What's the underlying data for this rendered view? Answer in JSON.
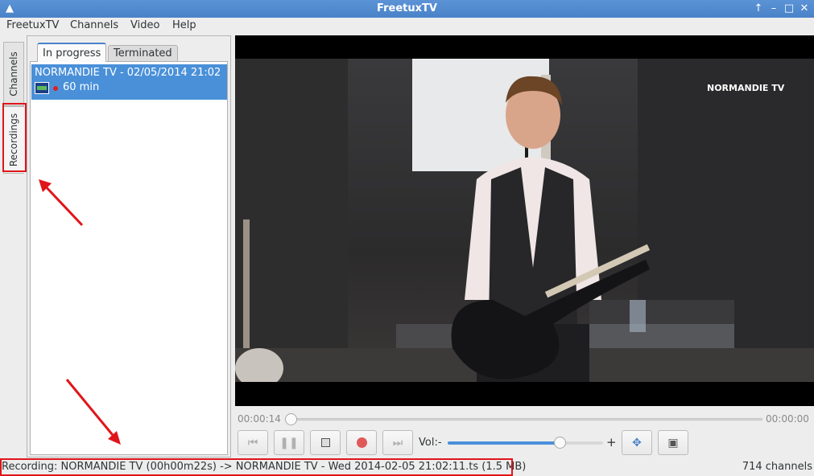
{
  "window": {
    "title": "FreetuxTV",
    "app_icon": "tux-icon",
    "buttons": [
      "keep-above-icon",
      "minimize-icon",
      "maximize-icon",
      "close-icon"
    ]
  },
  "menubar": {
    "items": [
      "FreetuxTV",
      "Channels",
      "Video",
      "Help"
    ]
  },
  "side_tabs": {
    "channels": "Channels",
    "recordings": "Recordings",
    "active": "Recordings"
  },
  "recordings_panel": {
    "tabs": [
      "In progress",
      "Terminated"
    ],
    "active_tab": "In progress",
    "items": [
      {
        "title": "NORMANDIE TV - 02/05/2014 21:02",
        "duration": "60 min",
        "recording": true
      }
    ]
  },
  "video": {
    "channel_logo_text": "NORMANDIE TV"
  },
  "playback": {
    "elapsed": "00:00:14",
    "total": "00:00:00",
    "volume_label": "Vol:-",
    "volume_plus": "+",
    "volume_level": 0.72,
    "buttons": [
      "previous-icon",
      "pause-icon",
      "stop-icon",
      "record-icon",
      "next-icon",
      "fullscreen-icon",
      "mini-mode-icon"
    ]
  },
  "statusbar": {
    "recording_text": "Recording: NORMANDIE TV (00h00m22s) -> NORMANDIE TV - Wed 2014-02-05 21:02:11.ts (1.5 MB)",
    "channel_count": "714 channels"
  },
  "colors": {
    "titlebar": "#4a82c8",
    "selection": "#4a90d9",
    "highlight": "#e0151a",
    "record": "#e02020"
  }
}
